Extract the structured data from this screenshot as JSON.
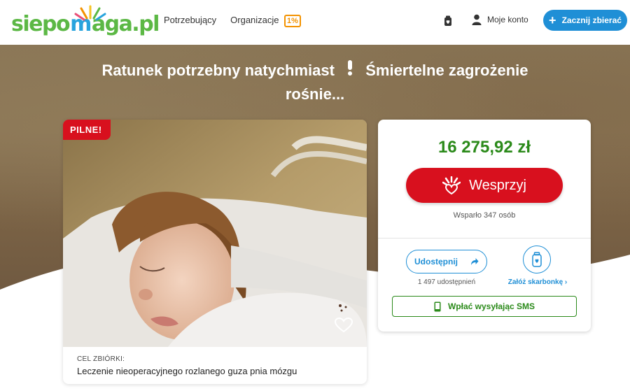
{
  "header": {
    "logo_left": "siepo",
    "logo_right": "aga.pl",
    "nav": [
      "Potrzebujący",
      "Organizacje"
    ],
    "one_percent": "1%",
    "account_label": "Moje konto",
    "start_label": "Zacznij zbierać"
  },
  "hero": {
    "title_part1": "Ratunek potrzebny natychmiast",
    "title_excl": "❗",
    "title_part2": "Śmiertelne zagrożenie rośnie..."
  },
  "photo_card": {
    "badge": "PILNE!",
    "goal_label": "CEL ZBIÓRKI:",
    "goal_text": "Leczenie nieoperacyjnego rozlanego guza pnia mózgu"
  },
  "donation": {
    "amount": "16 275,92 zł",
    "donate_label": "Wesprzyj",
    "supporters": "Wsparło 347 osób",
    "share_label": "Udostępnij",
    "share_count": "1 497 udostępnień",
    "piggy_label": "Załóż skarbonkę ›",
    "sms_label": "Wpłać wysyłając SMS"
  },
  "colors": {
    "brand_green": "#5cb845",
    "brand_blue": "#28a3dd",
    "primary_blue": "#1f8fd6",
    "donate_red": "#d8101e",
    "amount_green": "#2b8a1a",
    "one_percent_orange": "#f39200"
  }
}
